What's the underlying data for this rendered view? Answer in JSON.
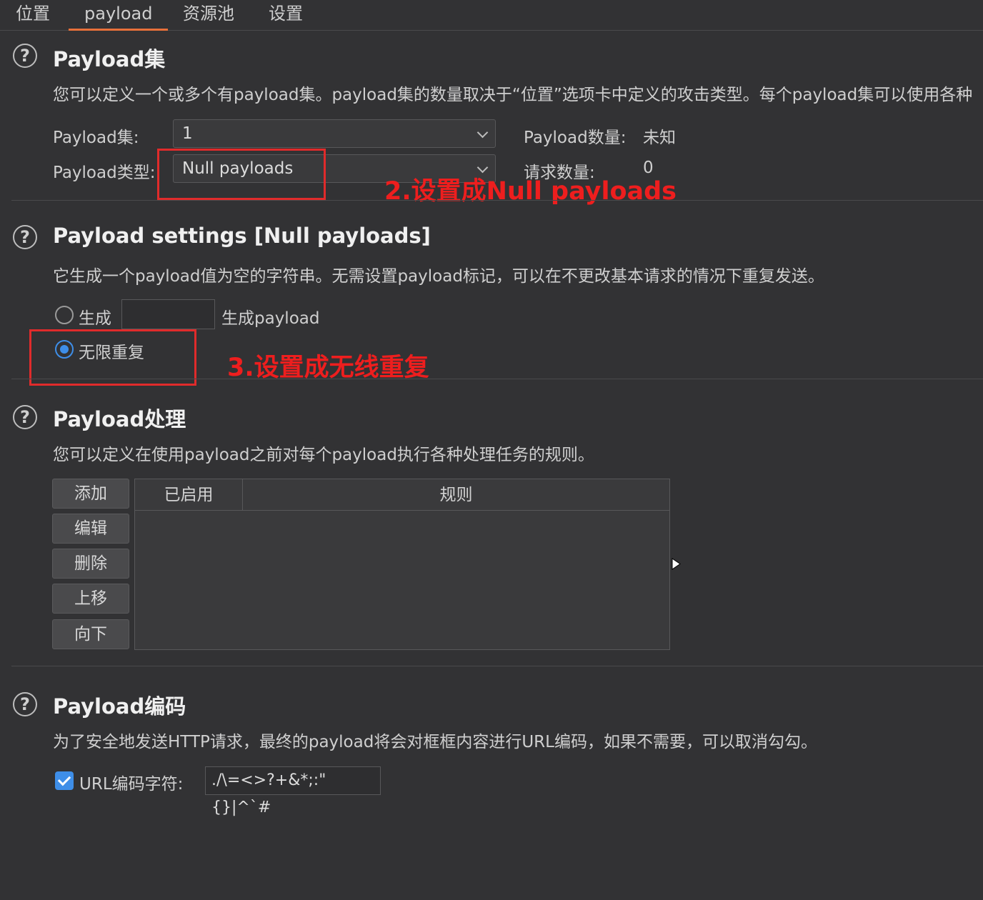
{
  "tabs": [
    "位置",
    "payload",
    "资源池",
    "设置"
  ],
  "help_glyph": "?",
  "payload_sets": {
    "title": "Payload集",
    "description": "您可以定义一个或多个有payload集。payload集的数量取决于“位置”选项卡中定义的攻击类型。每个payload集可以使用各种",
    "set_label": "Payload集:",
    "set_value": "1",
    "type_label": "Payload类型:",
    "type_value": "Null payloads",
    "count_label": "Payload数量:",
    "count_value": "未知",
    "requests_label": "请求数量:",
    "requests_value": "0"
  },
  "payload_settings": {
    "title": "Payload settings [Null payloads]",
    "description": "它生成一个payload值为空的字符串。无需设置payload标记，可以在不更改基本请求的情况下重复发送。",
    "generate_label": "生成",
    "generate_value": "",
    "generate_suffix": "生成payload",
    "infinite_label": "无限重复",
    "selected_option": "无限重复"
  },
  "payload_processing": {
    "title": "Payload处理",
    "description": "您可以定义在使用payload之前对每个payload执行各种处理任务的规则。",
    "buttons": [
      "添加",
      "编辑",
      "删除",
      "上移",
      "向下"
    ],
    "columns": [
      "已启用",
      "规则"
    ],
    "rows": []
  },
  "payload_encoding": {
    "title": "Payload编码",
    "description": "为了安全地发送HTTP请求，最终的payload将会对框框内容进行URL编码，如果不需要，可以取消勾勾。",
    "checkbox_label": "URL编码字符:",
    "checked": true,
    "chars_value": "./\\=<>?+&*;:\"{}|^`#"
  },
  "annotations": {
    "step2": "2.设置成Null payloads",
    "step3": "3.设置成无线重复"
  },
  "colors": {
    "background": "#323234",
    "accent_tab": "#e8703a",
    "annotation_red": "#ee1e1e",
    "radio_blue": "#3e8ee8"
  }
}
